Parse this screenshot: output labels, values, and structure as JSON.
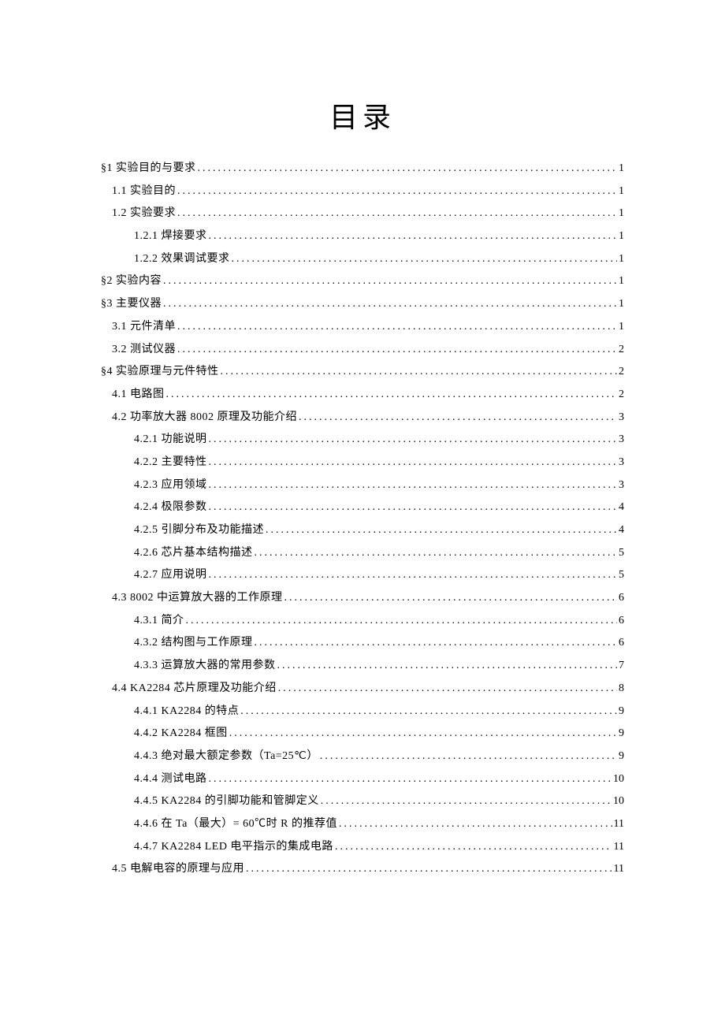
{
  "title": "目录",
  "entries": [
    {
      "label": "§1 实验目的与要求",
      "page": "1",
      "indent": 0
    },
    {
      "label": "1.1 实验目的",
      "page": "1",
      "indent": 1
    },
    {
      "label": "1.2 实验要求",
      "page": "1",
      "indent": 1
    },
    {
      "label": "1.2.1 焊接要求",
      "page": "1",
      "indent": 2
    },
    {
      "label": "1.2.2 效果调试要求",
      "page": "1",
      "indent": 2
    },
    {
      "label": "§2 实验内容",
      "page": "1",
      "indent": 0
    },
    {
      "label": "§3 主要仪器",
      "page": "1",
      "indent": 0
    },
    {
      "label": "3.1 元件清单",
      "page": "1",
      "indent": 1
    },
    {
      "label": "3.2 测试仪器",
      "page": "2",
      "indent": 1
    },
    {
      "label": "§4 实验原理与元件特性",
      "page": "2",
      "indent": 0
    },
    {
      "label": "4.1 电路图",
      "page": "2",
      "indent": 1
    },
    {
      "label": "4.2 功率放大器 8002 原理及功能介绍",
      "page": "3",
      "indent": 1
    },
    {
      "label": "4.2.1 功能说明",
      "page": "3",
      "indent": 2
    },
    {
      "label": "4.2.2 主要特性",
      "page": "3",
      "indent": 2
    },
    {
      "label": "4.2.3 应用领域",
      "page": "3",
      "indent": 2
    },
    {
      "label": "4.2.4 极限参数",
      "page": "4",
      "indent": 2
    },
    {
      "label": "4.2.5 引脚分布及功能描述",
      "page": "4",
      "indent": 2
    },
    {
      "label": "4.2.6 芯片基本结构描述",
      "page": "5",
      "indent": 2
    },
    {
      "label": "4.2.7 应用说明",
      "page": "5",
      "indent": 2
    },
    {
      "label": "4.3 8002 中运算放大器的工作原理",
      "page": "6",
      "indent": 1
    },
    {
      "label": "4.3.1 简介",
      "page": "6",
      "indent": 2
    },
    {
      "label": "4.3.2 结构图与工作原理",
      "page": "6",
      "indent": 2
    },
    {
      "label": "4.3.3 运算放大器的常用参数",
      "page": "7",
      "indent": 2
    },
    {
      "label": "4.4 KA2284 芯片原理及功能介绍",
      "page": "8",
      "indent": 1
    },
    {
      "label": "4.4.1 KA2284 的特点",
      "page": "9",
      "indent": 2
    },
    {
      "label": "4.4.2 KA2284 框图",
      "page": "9",
      "indent": 2
    },
    {
      "label": "4.4.3 绝对最大额定参数（Ta=25℃）",
      "page": "9",
      "indent": 2
    },
    {
      "label": "4.4.4 测试电路",
      "page": "10",
      "indent": 2
    },
    {
      "label": "4.4.5 KA2284 的引脚功能和管脚定义",
      "page": "10",
      "indent": 2
    },
    {
      "label": "4.4.6 在 Ta（最大）= 60℃时 R 的推荐值",
      "page": "11",
      "indent": 2
    },
    {
      "label": "4.4.7 KA2284 LED 电平指示的集成电路",
      "page": "11",
      "indent": 2
    },
    {
      "label": "4.5 电解电容的原理与应用",
      "page": "11",
      "indent": 1
    }
  ]
}
